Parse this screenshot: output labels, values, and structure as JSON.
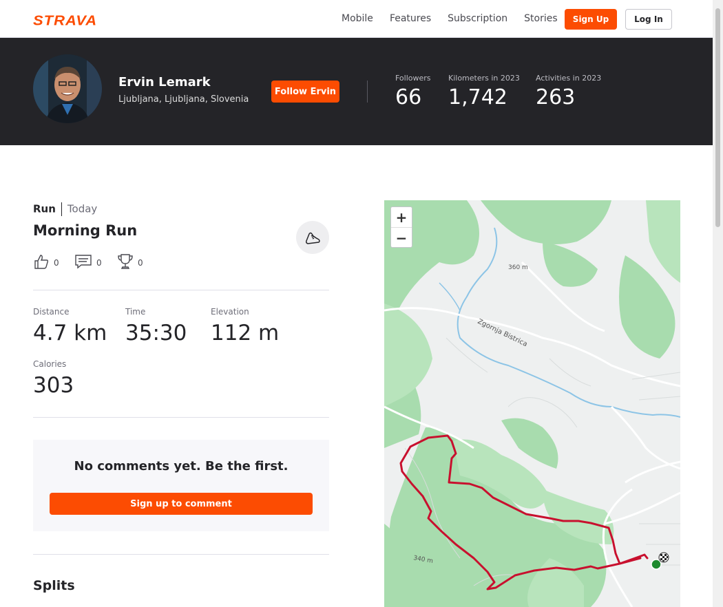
{
  "nav": {
    "logo": "STRAVA",
    "links": [
      "Mobile",
      "Features",
      "Subscription",
      "Stories"
    ],
    "signup": "Sign Up",
    "login": "Log In"
  },
  "athlete": {
    "name": "Ervin Lemark",
    "location": "Ljubljana, Ljubljana, Slovenia",
    "follow": "Follow Ervin",
    "stats": [
      {
        "label": "Followers",
        "value": "66"
      },
      {
        "label": "Kilometers in 2023",
        "value": "1,742"
      },
      {
        "label": "Activities in 2023",
        "value": "263"
      }
    ]
  },
  "activity": {
    "type": "Run",
    "when": "Today",
    "title": "Morning Run",
    "kudos": "0",
    "comments": "0",
    "achievements": "0",
    "metrics": [
      {
        "label": "Distance",
        "value": "4.7 km"
      },
      {
        "label": "Time",
        "value": "35:30"
      },
      {
        "label": "Elevation",
        "value": "112 m"
      },
      {
        "label": "Calories",
        "value": "303"
      }
    ]
  },
  "comment_box": {
    "message": "No comments yet. Be the first.",
    "button": "Sign up to comment"
  },
  "splits_title": "Splits",
  "map": {
    "zoom_in": "+",
    "zoom_out": "−",
    "labels": [
      "360 m",
      "Zgornja Bistrica",
      "340 m"
    ]
  },
  "colors": {
    "accent": "#fc4c02",
    "hero_bg": "#242428",
    "route": "#c8102e"
  }
}
